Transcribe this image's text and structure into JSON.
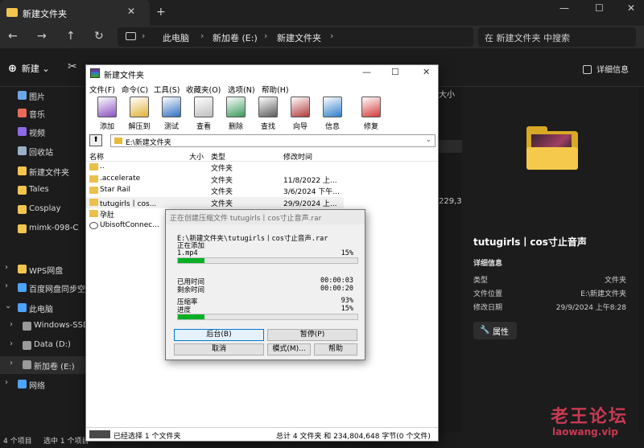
{
  "explorer": {
    "tab_title": "新建文件夹",
    "breadcrumbs": [
      "此电脑",
      "新加卷 (E:)",
      "新建文件夹"
    ],
    "search_placeholder": "在 新建文件夹 中搜索",
    "cmd_new": "新建",
    "cmd_details": "详细信息",
    "sidebar": [
      {
        "label": "图片",
        "icon": "pictures-icon",
        "color": "#6aa7e8"
      },
      {
        "label": "音乐",
        "icon": "music-icon",
        "color": "#e86a5a"
      },
      {
        "label": "视频",
        "icon": "video-icon",
        "color": "#8c6ae8"
      },
      {
        "label": "回收站",
        "icon": "recycle-bin-icon",
        "color": "#9ab0c8"
      },
      {
        "label": "新建文件夹",
        "icon": "folder-icon",
        "color": "#f2c54f"
      },
      {
        "label": "Tales",
        "icon": "folder-icon",
        "color": "#f2c54f"
      },
      {
        "label": "Cosplay",
        "icon": "folder-icon",
        "color": "#f2c54f"
      },
      {
        "label": "mimk-098-C",
        "icon": "folder-icon",
        "color": "#f2c54f"
      },
      {
        "label": "WPS网盘",
        "icon": "cloud-drive-icon",
        "color": "#f2c54f"
      },
      {
        "label": "百度网盘同步空间",
        "icon": "sync-folder-icon",
        "color": "#4da3ff"
      },
      {
        "label": "此电脑",
        "icon": "computer-icon",
        "color": "#4da3ff"
      },
      {
        "label": "Windows-SSD",
        "icon": "drive-icon",
        "color": "#9a9a9a"
      },
      {
        "label": "Data (D:)",
        "icon": "drive-icon",
        "color": "#9a9a9a"
      },
      {
        "label": "新加卷 (E:)",
        "icon": "drive-icon",
        "color": "#9a9a9a"
      },
      {
        "label": "网络",
        "icon": "network-icon",
        "color": "#4da3ff"
      }
    ],
    "bg_fragments": {
      "size_header": "大小",
      "size_value": "229,30"
    },
    "details": {
      "title": "tutugirls丨cos寸止音声",
      "section": "详细信息",
      "rows": [
        {
          "key": "类型",
          "value": "文件夹"
        },
        {
          "key": "文件位置",
          "value": "E:\\新建文件夹"
        },
        {
          "key": "修改日期",
          "value": "29/9/2024 上午8:28"
        }
      ],
      "properties_button": "属性"
    },
    "status": {
      "count": "4 个项目",
      "selected": "选中 1 个项目"
    }
  },
  "winrar": {
    "title": "新建文件夹",
    "menu": [
      "文件(F)",
      "命令(C)",
      "工具(S)",
      "收藏夹(O)",
      "选项(N)",
      "帮助(H)"
    ],
    "toolbar": [
      {
        "label": "添加",
        "icon": "add-archive-icon"
      },
      {
        "label": "解压到",
        "icon": "extract-icon"
      },
      {
        "label": "测试",
        "icon": "test-icon"
      },
      {
        "label": "查看",
        "icon": "view-icon"
      },
      {
        "label": "删除",
        "icon": "delete-icon"
      },
      {
        "label": "查找",
        "icon": "find-icon"
      },
      {
        "label": "向导",
        "icon": "wizard-icon"
      },
      {
        "label": "信息",
        "icon": "info-icon"
      },
      {
        "label": "修复",
        "icon": "repair-icon"
      }
    ],
    "path": "E:\\新建文件夹",
    "columns": [
      "名称",
      "大小",
      "类型",
      "修改时间"
    ],
    "rows": [
      {
        "name": "..",
        "size": "",
        "type": "文件夹",
        "modified": ""
      },
      {
        "name": ".accelerate",
        "size": "",
        "type": "文件夹",
        "modified": "11/8/2022 上..."
      },
      {
        "name": "Star Rail",
        "size": "",
        "type": "文件夹",
        "modified": "3/6/2024 下午..."
      },
      {
        "name": "tutugirls丨cos...",
        "size": "",
        "type": "文件夹",
        "modified": "29/9/2024 上..."
      },
      {
        "name": "孕肚",
        "size": "",
        "type": "",
        "modified": ""
      },
      {
        "name": "UbisoftConnec...",
        "size": "",
        "type": "",
        "modified": ""
      }
    ],
    "status_left": "已经选择 1 个文件夹",
    "status_right": "总计 4 文件夹 和 234,804,648 字节(0 个文件)"
  },
  "progress_dialog": {
    "title": "正在创建压缩文件 tutugirls丨cos寸止音声.rar",
    "archive_path": "E:\\新建文件夹\\tutugirls丨cos寸止音声.rar",
    "action": "正在添加",
    "current_file": "1.mp4",
    "file_percent": "15%",
    "file_progress": 0.15,
    "elapsed_label": "已用时间",
    "elapsed_value": "00:00:03",
    "remaining_label": "剩余时间",
    "remaining_value": "00:00:20",
    "ratio_label": "压缩率",
    "ratio_value": "93%",
    "progress_label": "进度",
    "progress_value": "15%",
    "total_progress": 0.15,
    "buttons": {
      "background": "后台(B)",
      "pause": "暂停(P)",
      "cancel": "取消",
      "mode": "模式(M)...",
      "help": "帮助"
    }
  },
  "watermark": {
    "line1": "老王论坛",
    "line2": "laowang.vip"
  },
  "colors": {
    "accent": "#0078d7",
    "progress_green": "#06b025",
    "folder_yellow": "#f2c54f",
    "watermark_red": "#c93a52"
  }
}
